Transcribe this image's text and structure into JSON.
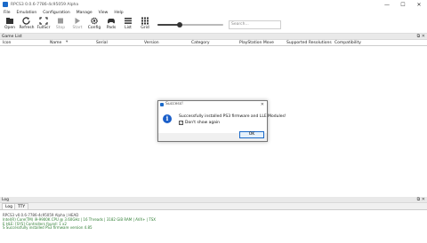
{
  "window": {
    "title": "RPCS3 0.0.6-7786-4c95059 Alpha",
    "controls": [
      "—",
      "☐",
      "✕"
    ]
  },
  "menu": [
    "File",
    "Emulation",
    "Configuration",
    "Manage",
    "View",
    "Help"
  ],
  "toolbar": {
    "buttons": [
      {
        "label": "Open",
        "icon": "folder-open-icon",
        "enabled": true
      },
      {
        "label": "Refresh",
        "icon": "refresh-icon",
        "enabled": true
      },
      {
        "label": "FullScr",
        "icon": "fullscreen-icon",
        "enabled": true
      },
      {
        "label": "Stop",
        "icon": "stop-icon",
        "enabled": false
      },
      {
        "label": "Start",
        "icon": "play-icon",
        "enabled": false
      },
      {
        "label": "Config",
        "icon": "gear-icon",
        "enabled": true
      },
      {
        "label": "Pads",
        "icon": "gamepad-icon",
        "enabled": true
      },
      {
        "label": "List",
        "icon": "list-icon",
        "enabled": true
      },
      {
        "label": "Grid",
        "icon": "grid-icon",
        "enabled": true
      }
    ],
    "zoom_slider_level": 0.34,
    "search_placeholder": "Search..."
  },
  "game_list": {
    "title": "Game List",
    "columns": [
      "Icon",
      "Name",
      "Serial",
      "Version",
      "Category",
      "PlayStation Move",
      "Supported Resolutions",
      "Compatibility"
    ],
    "rows": []
  },
  "log": {
    "title": "Log",
    "tabs": [
      "Log",
      "TTY"
    ],
    "active_tab": "Log",
    "lines": [
      {
        "text": "RPCS3 v0.0.6-7786-4c95059 Alpha | HEAD",
        "color": "#444444"
      },
      {
        "text": "Intel(R) Core(TM) i9-9900K CPU @ 3.60GHz | 16 Threads | 3182 GiB RAM | AVX+ | TSX",
        "color": "#2e7d32"
      },
      {
        "text": "E HLE: [SYS] Controllers found: 1 x2",
        "color": "#2e7d32"
      },
      {
        "text": "S Successfully installed PS3 firmware version 4.85",
        "color": "#2e7d32"
      }
    ]
  },
  "dialog": {
    "title": "Success!",
    "message": "Successfully installed PS3 firmware and LLE Modules!",
    "checkbox_label": "Don't show again",
    "checkbox_checked": true,
    "ok_label": "OK"
  },
  "colors": {
    "accent": "#1b6ac9",
    "log_green": "#2e7d32"
  }
}
